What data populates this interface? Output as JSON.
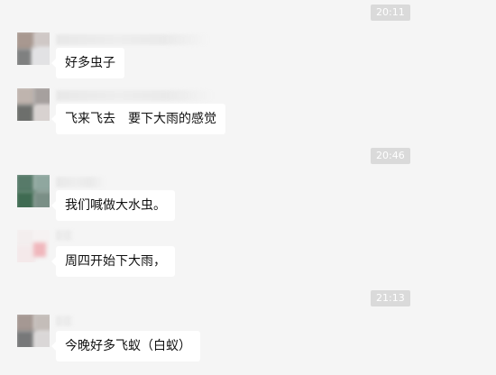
{
  "timestamps": [
    "20:11",
    "20:46",
    "21:13"
  ],
  "messages": [
    {
      "text": "好多虫子"
    },
    {
      "text": "飞来飞去　要下大雨的感觉"
    },
    {
      "text": "我们喊做大水虫。"
    },
    {
      "text": "周四开始下大雨，"
    },
    {
      "text": "今晚好多飞蚁（白蚁）"
    }
  ]
}
